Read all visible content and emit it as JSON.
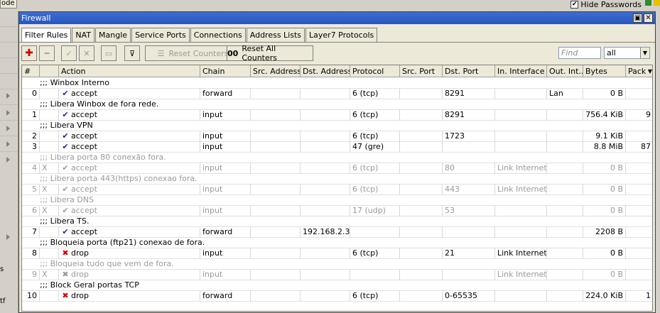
{
  "topbar": {
    "mode_label": "ode",
    "hide_passwords_label": "Hide Passwords",
    "hide_passwords_checked": true
  },
  "leftstrip": {
    "labels": [
      "s",
      "tf"
    ]
  },
  "window": {
    "title": "Firewall",
    "restore_glyph": "▣",
    "close_glyph": "✕"
  },
  "tabs": [
    "Filter Rules",
    "NAT",
    "Mangle",
    "Service Ports",
    "Connections",
    "Address Lists",
    "Layer7 Protocols"
  ],
  "toolbar": {
    "add_glyph": "✚",
    "remove_glyph": "━",
    "enable_glyph": "✓",
    "disable_glyph": "✕",
    "comment_glyph": "▭",
    "filter_glyph": "⊽",
    "reset_counters": "Reset Counters",
    "reset_all_counters": "Reset All Counters",
    "reset_all_glyph": "00",
    "find_placeholder": "Find",
    "filter_value": "all"
  },
  "columns": [
    "#",
    "Action",
    "Chain",
    "Src. Address",
    "Dst. Address",
    "Protocol",
    "Src. Port",
    "Dst. Port",
    "In. Interface",
    "Out. Int...",
    "Bytes",
    "Pack"
  ],
  "rows": [
    {
      "type": "comment",
      "text": ";;; Winbox Interno",
      "disabled": false
    },
    {
      "type": "rule",
      "num": "0",
      "x": "",
      "action": "accept",
      "chain": "forward",
      "src": "",
      "dst": "",
      "proto": "6 (tcp)",
      "sport": "",
      "dport": "8291",
      "inif": "",
      "outif": "Lan",
      "bytes": "0 B",
      "packets": "",
      "disabled": false
    },
    {
      "type": "comment",
      "text": ";;; Libera Winbox de fora rede.",
      "disabled": false
    },
    {
      "type": "rule",
      "num": "1",
      "x": "",
      "action": "accept",
      "chain": "input",
      "src": "",
      "dst": "",
      "proto": "6 (tcp)",
      "sport": "",
      "dport": "8291",
      "inif": "",
      "outif": "",
      "bytes": "756.4 KiB",
      "packets": "9",
      "disabled": false
    },
    {
      "type": "comment",
      "text": ";;; Libera VPN",
      "disabled": false
    },
    {
      "type": "rule",
      "num": "2",
      "x": "",
      "action": "accept",
      "chain": "input",
      "src": "",
      "dst": "",
      "proto": "6 (tcp)",
      "sport": "",
      "dport": "1723",
      "inif": "",
      "outif": "",
      "bytes": "9.1 KiB",
      "packets": "",
      "disabled": false
    },
    {
      "type": "rule",
      "num": "3",
      "x": "",
      "action": "accept",
      "chain": "input",
      "src": "",
      "dst": "",
      "proto": "47 (gre)",
      "sport": "",
      "dport": "",
      "inif": "",
      "outif": "",
      "bytes": "8.8 MiB",
      "packets": "87",
      "disabled": false
    },
    {
      "type": "comment",
      "text": ";;; Libera porta 80 conexão fora.",
      "disabled": true
    },
    {
      "type": "rule",
      "num": "4",
      "x": "X",
      "action": "accept",
      "chain": "input",
      "src": "",
      "dst": "",
      "proto": "6 (tcp)",
      "sport": "",
      "dport": "80",
      "inif": "Link Internet",
      "outif": "",
      "bytes": "0 B",
      "packets": "",
      "disabled": true
    },
    {
      "type": "comment",
      "text": ";;; Libera porta 443(https) conexao fora.",
      "disabled": true
    },
    {
      "type": "rule",
      "num": "5",
      "x": "X",
      "action": "accept",
      "chain": "input",
      "src": "",
      "dst": "",
      "proto": "6 (tcp)",
      "sport": "",
      "dport": "443",
      "inif": "Link Internet",
      "outif": "",
      "bytes": "0 B",
      "packets": "",
      "disabled": true
    },
    {
      "type": "comment",
      "text": ";;; Libera DNS",
      "disabled": true
    },
    {
      "type": "rule",
      "num": "6",
      "x": "X",
      "action": "accept",
      "chain": "input",
      "src": "",
      "dst": "",
      "proto": "17 (udp)",
      "sport": "",
      "dport": "53",
      "inif": "",
      "outif": "",
      "bytes": "0 B",
      "packets": "",
      "disabled": true
    },
    {
      "type": "comment",
      "text": ";;; Libera TS.",
      "disabled": false
    },
    {
      "type": "rule",
      "num": "7",
      "x": "",
      "action": "accept",
      "chain": "forward",
      "src": "",
      "dst": "192.168.2.3",
      "proto": "",
      "sport": "",
      "dport": "",
      "inif": "",
      "outif": "",
      "bytes": "2208 B",
      "packets": "",
      "disabled": false
    },
    {
      "type": "comment",
      "text": ";;; Bloqueia porta (ftp21) conexao de fora.",
      "disabled": false
    },
    {
      "type": "rule",
      "num": "8",
      "x": "",
      "action": "drop",
      "chain": "input",
      "src": "",
      "dst": "",
      "proto": "6 (tcp)",
      "sport": "",
      "dport": "21",
      "inif": "Link Internet",
      "outif": "",
      "bytes": "0 B",
      "packets": "",
      "disabled": false
    },
    {
      "type": "comment",
      "text": ";;; Bloqueia tudo que vem de fora.",
      "disabled": true
    },
    {
      "type": "rule",
      "num": "9",
      "x": "X",
      "action": "drop",
      "chain": "input",
      "src": "",
      "dst": "",
      "proto": "",
      "sport": "",
      "dport": "",
      "inif": "Link Internet",
      "outif": "",
      "bytes": "0 B",
      "packets": "",
      "disabled": true
    },
    {
      "type": "comment",
      "text": ";;; Block Geral portas TCP",
      "disabled": false
    },
    {
      "type": "rule",
      "num": "10",
      "x": "",
      "action": "drop",
      "chain": "forward",
      "src": "",
      "dst": "",
      "proto": "6 (tcp)",
      "sport": "",
      "dport": "0-65535",
      "inif": "",
      "outif": "",
      "bytes": "224.0 KiB",
      "packets": "1",
      "disabled": false
    }
  ],
  "icons": {
    "accept": "✔",
    "drop": "✖"
  }
}
